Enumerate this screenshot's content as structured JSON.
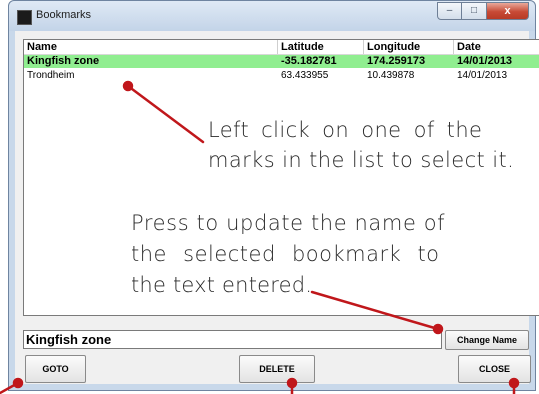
{
  "window": {
    "title": "Bookmarks",
    "controls": {
      "minimize": "–",
      "maximize": "□",
      "close": "x"
    }
  },
  "list": {
    "columns": [
      "Name",
      "Latitude",
      "Longitude",
      "Date"
    ],
    "rows": [
      {
        "name": "Kingfish zone",
        "latitude": "-35.182781",
        "longitude": "174.259173",
        "date": "14/01/2013",
        "selected": true
      },
      {
        "name": "Trondheim",
        "latitude": "63.433955",
        "longitude": "10.439878",
        "date": "14/01/2013",
        "selected": false
      }
    ]
  },
  "name_field": {
    "value": "Kingfish zone"
  },
  "buttons": {
    "change_name": "Change Name",
    "goto": "GOTO",
    "delete": "DELETE",
    "close": "CLOSE"
  },
  "annotations": {
    "select_line1": "Left click on one of the",
    "select_line2": "marks in the list to select it.",
    "update_line1": "Press to update the name of",
    "update_line2": "the selected bookmark to",
    "update_line3": "the text entered."
  },
  "colors": {
    "selected_row": "#90ee90",
    "annotation_line": "#c0171b",
    "titlebar": "#c8d8ea"
  }
}
